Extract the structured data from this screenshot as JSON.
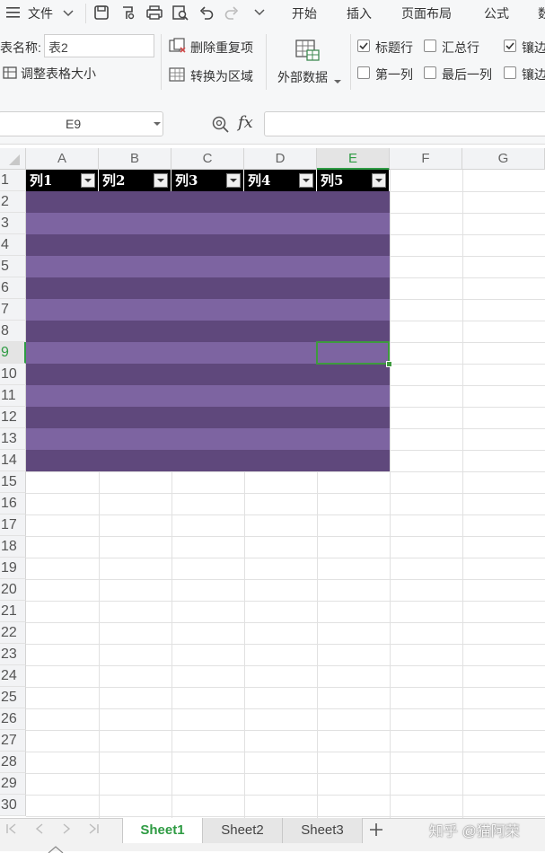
{
  "menubar": {
    "file_label": "文件",
    "tabs": [
      "开始",
      "插入",
      "页面布局",
      "公式",
      "数"
    ]
  },
  "ribbon": {
    "table_name_label": "表名称:",
    "table_name_value": "表2",
    "resize_table": "调整表格大小",
    "remove_duplicates": "删除重复项",
    "convert_to_range": "转换为区域",
    "external_data": "外部数据",
    "options": {
      "header_row": "标题行",
      "total_row": "汇总行",
      "banded_1": "镶边",
      "first_column": "第一列",
      "last_column": "最后一列",
      "banded_2": "镶边"
    }
  },
  "formula": {
    "cell_ref": "E9",
    "fx_label": "fx",
    "value": ""
  },
  "grid": {
    "columns": [
      "A",
      "B",
      "C",
      "D",
      "E",
      "F",
      "G"
    ],
    "rows": [
      "1",
      "2",
      "3",
      "4",
      "5",
      "6",
      "7",
      "8",
      "9",
      "10",
      "11",
      "12",
      "13",
      "14",
      "15",
      "16",
      "17",
      "18",
      "19",
      "20",
      "21",
      "22",
      "23",
      "24",
      "25",
      "26",
      "27",
      "28",
      "29",
      "30"
    ],
    "selected_cell": "E9",
    "table_headers": [
      "列1",
      "列2",
      "列3",
      "列4",
      "列5"
    ],
    "band_colors": {
      "dark": "#5f487c",
      "light": "#7d64a1"
    },
    "header_color": "#000000",
    "selection_color": "#3e9a3e"
  },
  "sheets": {
    "tabs": [
      "Sheet1",
      "Sheet2",
      "Sheet3"
    ],
    "active": "Sheet1",
    "active_color": "#2e9b43"
  },
  "watermark": "知乎 @猫阿荣"
}
